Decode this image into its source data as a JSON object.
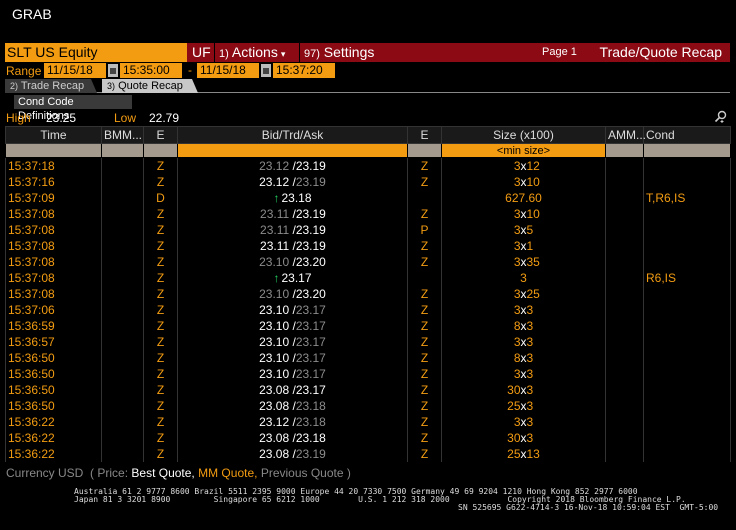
{
  "window": {
    "title": "GRAB"
  },
  "commandbar": {
    "security": "SLT US Equity",
    "uf": "UF",
    "actions_num": "1)",
    "actions_label": "Actions",
    "settings_num": "97)",
    "settings_label": "Settings",
    "page_label": "Page 1",
    "function_title": "Trade/Quote Recap",
    "colors": {
      "bar": "#8b0a14",
      "accent": "#f39c12"
    }
  },
  "range": {
    "label": "Range",
    "start_date": "11/15/18",
    "start_time": "15:35:00",
    "separator": "-",
    "end_date": "11/15/18",
    "end_time": "15:37:20"
  },
  "tabs": [
    {
      "num": "2)",
      "label": "Trade Recap"
    },
    {
      "num": "3)",
      "label": "Quote Recap"
    }
  ],
  "cond_button": "Cond Code Definitions",
  "stats": {
    "high_label": "High",
    "high": "23.25",
    "low_label": "Low",
    "low": "22.79"
  },
  "table": {
    "headers": [
      "Time",
      "BMM...",
      "E",
      "Bid/Trd/Ask",
      "E",
      "Size (x100)",
      "AMM...",
      "Cond"
    ],
    "size_filter": "<min size>",
    "rows": [
      {
        "time": "15:37:18",
        "e": "Z",
        "kind": "quote",
        "bid": "23.12",
        "bid_dim": true,
        "ask": "23.19",
        "ask_dim": false,
        "e2": "Z",
        "bs": "3",
        "as": "12",
        "cond": ""
      },
      {
        "time": "15:37:16",
        "e": "Z",
        "kind": "quote",
        "bid": "23.12",
        "bid_dim": false,
        "ask": "23.19",
        "ask_dim": true,
        "e2": "Z",
        "bs": "3",
        "as": "10",
        "cond": ""
      },
      {
        "time": "15:37:09",
        "e": "D",
        "kind": "trade",
        "price": "23.18",
        "size": "627.60",
        "cond": "T,R6,IS"
      },
      {
        "time": "15:37:08",
        "e": "Z",
        "kind": "quote",
        "bid": "23.11",
        "bid_dim": true,
        "ask": "23.19",
        "ask_dim": false,
        "e2": "Z",
        "bs": "3",
        "as": "10",
        "cond": ""
      },
      {
        "time": "15:37:08",
        "e": "Z",
        "kind": "quote",
        "bid": "23.11",
        "bid_dim": true,
        "ask": "23.19",
        "ask_dim": false,
        "e2": "P",
        "bs": "3",
        "as": "5",
        "cond": ""
      },
      {
        "time": "15:37:08",
        "e": "Z",
        "kind": "quote",
        "bid": "23.11",
        "bid_dim": false,
        "ask": "23.19",
        "ask_dim": false,
        "e2": "Z",
        "bs": "3",
        "as": "1",
        "cond": ""
      },
      {
        "time": "15:37:08",
        "e": "Z",
        "kind": "quote",
        "bid": "23.10",
        "bid_dim": true,
        "ask": "23.20",
        "ask_dim": false,
        "e2": "Z",
        "bs": "3",
        "as": "35",
        "cond": ""
      },
      {
        "time": "15:37:08",
        "e": "Z",
        "kind": "trade",
        "price": "23.17",
        "size": "3",
        "cond": "R6,IS"
      },
      {
        "time": "15:37:08",
        "e": "Z",
        "kind": "quote",
        "bid": "23.10",
        "bid_dim": true,
        "ask": "23.20",
        "ask_dim": false,
        "e2": "Z",
        "bs": "3",
        "as": "25",
        "cond": ""
      },
      {
        "time": "15:37:06",
        "e": "Z",
        "kind": "quote",
        "bid": "23.10",
        "bid_dim": false,
        "ask": "23.17",
        "ask_dim": true,
        "e2": "Z",
        "bs": "3",
        "as": "3",
        "cond": ""
      },
      {
        "time": "15:36:59",
        "e": "Z",
        "kind": "quote",
        "bid": "23.10",
        "bid_dim": false,
        "ask": "23.17",
        "ask_dim": true,
        "e2": "Z",
        "bs": "8",
        "as": "3",
        "cond": ""
      },
      {
        "time": "15:36:57",
        "e": "Z",
        "kind": "quote",
        "bid": "23.10",
        "bid_dim": false,
        "ask": "23.17",
        "ask_dim": true,
        "e2": "Z",
        "bs": "3",
        "as": "3",
        "cond": ""
      },
      {
        "time": "15:36:50",
        "e": "Z",
        "kind": "quote",
        "bid": "23.10",
        "bid_dim": false,
        "ask": "23.17",
        "ask_dim": true,
        "e2": "Z",
        "bs": "8",
        "as": "3",
        "cond": ""
      },
      {
        "time": "15:36:50",
        "e": "Z",
        "kind": "quote",
        "bid": "23.10",
        "bid_dim": false,
        "ask": "23.17",
        "ask_dim": true,
        "e2": "Z",
        "bs": "3",
        "as": "3",
        "cond": ""
      },
      {
        "time": "15:36:50",
        "e": "Z",
        "kind": "quote",
        "bid": "23.08",
        "bid_dim": false,
        "ask": "23.17",
        "ask_dim": false,
        "e2": "Z",
        "bs": "30",
        "as": "3",
        "cond": ""
      },
      {
        "time": "15:36:50",
        "e": "Z",
        "kind": "quote",
        "bid": "23.08",
        "bid_dim": false,
        "ask": "23.18",
        "ask_dim": true,
        "e2": "Z",
        "bs": "25",
        "as": "3",
        "cond": ""
      },
      {
        "time": "15:36:22",
        "e": "Z",
        "kind": "quote",
        "bid": "23.12",
        "bid_dim": false,
        "ask": "23.18",
        "ask_dim": true,
        "e2": "Z",
        "bs": "3",
        "as": "3",
        "cond": ""
      },
      {
        "time": "15:36:22",
        "e": "Z",
        "kind": "quote",
        "bid": "23.08",
        "bid_dim": false,
        "ask": "23.18",
        "ask_dim": false,
        "e2": "Z",
        "bs": "30",
        "as": "3",
        "cond": ""
      },
      {
        "time": "15:36:22",
        "e": "Z",
        "kind": "quote",
        "bid": "23.08",
        "bid_dim": false,
        "ask": "23.19",
        "ask_dim": true,
        "e2": "Z",
        "bs": "25",
        "as": "13",
        "cond": ""
      }
    ]
  },
  "legend": {
    "currency": "Currency USD",
    "open": "( Price:",
    "best": "Best Quote,",
    "mm": "MM Quote,",
    "prev": "Previous Quote",
    "close": ")"
  },
  "footer": {
    "line1": "Australia 61 2 9777 8600 Brazil 5511 2395 9000 Europe 44 20 7330 7500 Germany 49 69 9204 1210 Hong Kong 852 2977 6000",
    "line2": "Japan 81 3 3201 8900         Singapore 65 6212 1000        U.S. 1 212 318 2000            Copyright 2018 Bloomberg Finance L.P.",
    "line3": "SN 525695 G622-4714-3 16-Nov-18 10:59:04 EST  GMT-5:00"
  }
}
